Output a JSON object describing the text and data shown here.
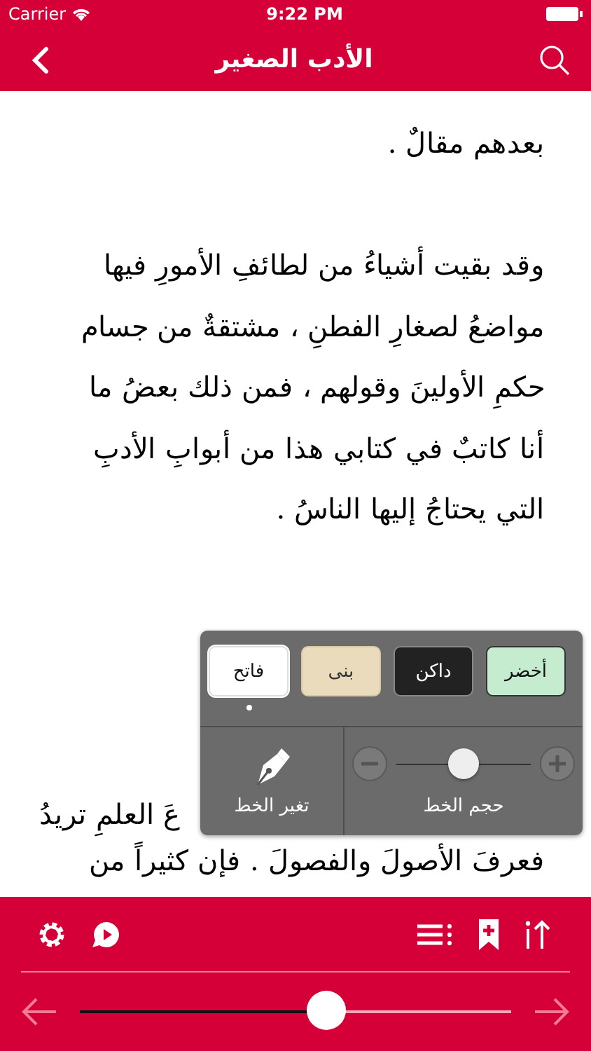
{
  "status_bar": {
    "carrier": "Carrier",
    "time": "9:22 PM"
  },
  "nav": {
    "title": "الأدب الصغير"
  },
  "text_lines": [
    {
      "text": "بعدهم مقالٌ .",
      "kind": "line"
    },
    {
      "kind": "gap"
    },
    {
      "text": "وقد بقيت أشياءُ من لطائفِ الأمورِ فيها",
      "kind": "line"
    },
    {
      "text": "مواضعُ لصغارِ الفطنِ ، مشتقةٌ من جسام",
      "kind": "line"
    },
    {
      "text": "حكمِ الأولينَ وقولهم ، فمن ذلك بعضُ ما",
      "kind": "line"
    },
    {
      "text": "أنا كاتبٌ في كتابي هذا من أبوابِ الأدبِ",
      "kind": "line"
    },
    {
      "text": "التي يحتاجُ إليها الناسُ .",
      "kind": "line"
    },
    {
      "kind": "gap"
    },
    {
      "kind": "gap"
    },
    {
      "kind": "gap"
    },
    {
      "kind": "gap"
    },
    {
      "text": "عَ العلمِ تريدُ",
      "kind": "partial"
    },
    {
      "text": "فعرفَ الأصولَ والفصولَ . فإن كثيراً من",
      "kind": "tail"
    }
  ],
  "popup": {
    "themes": [
      {
        "label": "أخضر",
        "kind": "green",
        "selected": false
      },
      {
        "label": "داكن",
        "kind": "dark",
        "selected": false
      },
      {
        "label": "بنى",
        "kind": "sepia",
        "selected": false
      },
      {
        "label": "فاتح",
        "kind": "light",
        "selected": true
      }
    ],
    "font_size": {
      "label": "حجم الخط",
      "level": 0.5
    },
    "font_change": {
      "label": "تغير الخط"
    }
  },
  "bottom_bar": {
    "progress": {
      "level": 0.57
    }
  }
}
